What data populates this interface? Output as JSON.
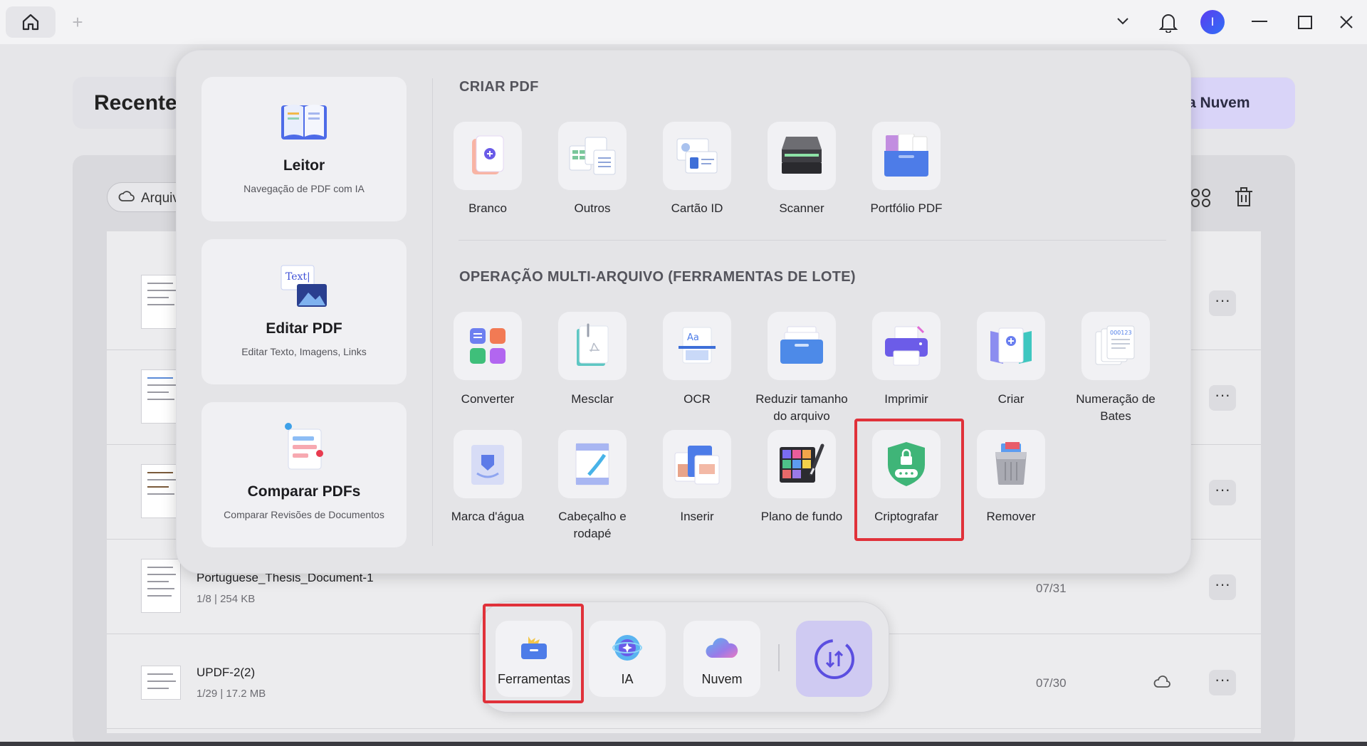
{
  "window": {
    "avatar_letter": "I",
    "icons": [
      "home-icon",
      "plus-icon",
      "chevron-down-icon",
      "bell-icon",
      "minimize-icon",
      "maximize-icon",
      "close-icon"
    ]
  },
  "background": {
    "title": "Recente",
    "cloud_button": "a Nuvem",
    "filter_label": "Arquiv",
    "files": [
      {
        "name": "Portuguese_Thesis_Document-1",
        "meta": "1/8 | 254 KB",
        "date": "07/31"
      },
      {
        "name": "UPDF-2(2)",
        "meta": "1/29 | 17.2 MB",
        "date": "07/30"
      }
    ]
  },
  "left_cards": [
    {
      "title": "Leitor",
      "subtitle": "Navegação de PDF com IA"
    },
    {
      "title": "Editar PDF",
      "subtitle": "Editar Texto, Imagens, Links"
    },
    {
      "title": "Comparar PDFs",
      "subtitle": "Comparar Revisões de Documentos"
    }
  ],
  "create_pdf": {
    "title": "CRIAR PDF",
    "tools": [
      "Branco",
      "Outros",
      "Cartão ID",
      "Scanner",
      "Portfólio PDF"
    ]
  },
  "batch": {
    "title": "OPERAÇÃO MULTI-ARQUIVO (FERRAMENTAS DE LOTE)",
    "row1": [
      {
        "line1": "Converter",
        "line2": ""
      },
      {
        "line1": "Mesclar",
        "line2": ""
      },
      {
        "line1": "OCR",
        "line2": ""
      },
      {
        "line1": "Reduzir tamanho",
        "line2": "do arquivo"
      },
      {
        "line1": "Imprimir",
        "line2": ""
      },
      {
        "line1": "Criar",
        "line2": ""
      },
      {
        "line1": "Numeração de",
        "line2": "Bates"
      }
    ],
    "row2": [
      {
        "line1": "Marca d'água",
        "line2": ""
      },
      {
        "line1": "Cabeçalho e",
        "line2": "rodapé"
      },
      {
        "line1": "Inserir",
        "line2": ""
      },
      {
        "line1": "Plano de fundo",
        "line2": ""
      },
      {
        "line1": "Criptografar",
        "line2": ""
      },
      {
        "line1": "Remover",
        "line2": ""
      }
    ]
  },
  "dock": {
    "items": [
      "Ferramentas",
      "IA",
      "Nuvem"
    ]
  },
  "colors": {
    "highlight": "#e0313a",
    "accent_purple": "#5b3cf0"
  }
}
